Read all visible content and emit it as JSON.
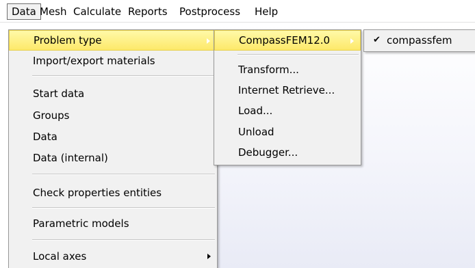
{
  "menubar": {
    "items": [
      "Data",
      "Mesh",
      "Calculate",
      "Reports",
      "Postprocess",
      "Help"
    ]
  },
  "main_menu": {
    "items": [
      "Problem type",
      "Import/export materials",
      "Start data",
      "Groups",
      "Data",
      "Data (internal)",
      "Check properties entities",
      "Parametric models",
      "Local axes"
    ]
  },
  "submenu": {
    "items": [
      "CompassFEM12.0",
      "Transform...",
      "Internet Retrieve...",
      "Load...",
      "Unload",
      "Debugger..."
    ]
  },
  "submenu2": {
    "check": "✔",
    "items": [
      "compassfem"
    ]
  }
}
